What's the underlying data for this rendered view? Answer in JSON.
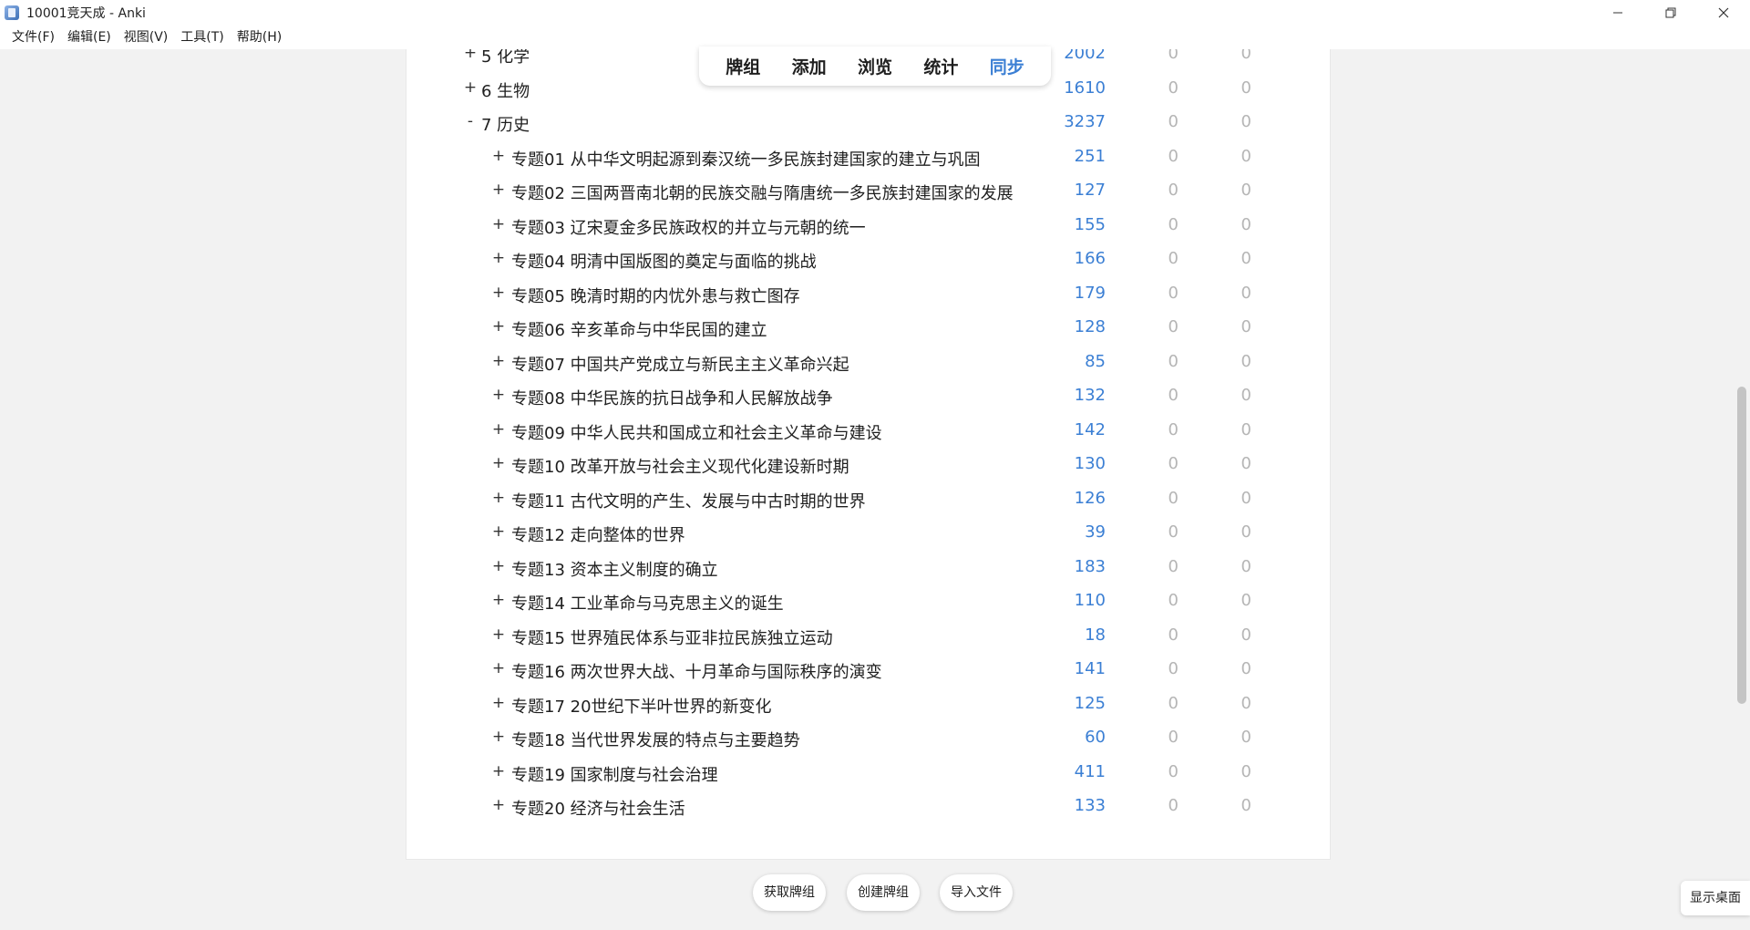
{
  "window": {
    "title": "10001竞天成 - Anki"
  },
  "menu": [
    {
      "label": "文件(F)"
    },
    {
      "label": "编辑(E)"
    },
    {
      "label": "视图(V)"
    },
    {
      "label": "工具(T)"
    },
    {
      "label": "帮助(H)"
    }
  ],
  "toolbar": {
    "tabs": [
      {
        "label": "牌组"
      },
      {
        "label": "添加"
      },
      {
        "label": "浏览"
      },
      {
        "label": "统计"
      },
      {
        "label": "同步"
      }
    ],
    "active_tab": "同步"
  },
  "decks": [
    {
      "toggle": "+",
      "name": "5 化学",
      "level": 0,
      "new": "2002",
      "learn": "0",
      "due": "0"
    },
    {
      "toggle": "+",
      "name": "6 生物",
      "level": 0,
      "new": "1610",
      "learn": "0",
      "due": "0"
    },
    {
      "toggle": "-",
      "name": "7 历史",
      "level": 0,
      "new": "3237",
      "learn": "0",
      "due": "0"
    },
    {
      "toggle": "+",
      "name": "专题01 从中华文明起源到秦汉统一多民族封建国家的建立与巩固",
      "level": 1,
      "new": "251",
      "learn": "0",
      "due": "0"
    },
    {
      "toggle": "+",
      "name": "专题02 三国两晋南北朝的民族交融与隋唐统一多民族封建国家的发展",
      "level": 1,
      "new": "127",
      "learn": "0",
      "due": "0"
    },
    {
      "toggle": "+",
      "name": "专题03 辽宋夏金多民族政权的并立与元朝的统一",
      "level": 1,
      "new": "155",
      "learn": "0",
      "due": "0"
    },
    {
      "toggle": "+",
      "name": "专题04 明清中国版图的奠定与面临的挑战",
      "level": 1,
      "new": "166",
      "learn": "0",
      "due": "0"
    },
    {
      "toggle": "+",
      "name": "专题05 晚清时期的内忧外患与救亡图存",
      "level": 1,
      "new": "179",
      "learn": "0",
      "due": "0"
    },
    {
      "toggle": "+",
      "name": "专题06 辛亥革命与中华民国的建立",
      "level": 1,
      "new": "128",
      "learn": "0",
      "due": "0"
    },
    {
      "toggle": "+",
      "name": "专题07 中国共产党成立与新民主主义革命兴起",
      "level": 1,
      "new": "85",
      "learn": "0",
      "due": "0"
    },
    {
      "toggle": "+",
      "name": "专题08 中华民族的抗日战争和人民解放战争",
      "level": 1,
      "new": "132",
      "learn": "0",
      "due": "0"
    },
    {
      "toggle": "+",
      "name": "专题09 中华人民共和国成立和社会主义革命与建设",
      "level": 1,
      "new": "142",
      "learn": "0",
      "due": "0"
    },
    {
      "toggle": "+",
      "name": "专题10 改革开放与社会主义现代化建设新时期",
      "level": 1,
      "new": "130",
      "learn": "0",
      "due": "0"
    },
    {
      "toggle": "+",
      "name": "专题11 古代文明的产生、发展与中古时期的世界",
      "level": 1,
      "new": "126",
      "learn": "0",
      "due": "0"
    },
    {
      "toggle": "+",
      "name": "专题12 走向整体的世界",
      "level": 1,
      "new": "39",
      "learn": "0",
      "due": "0"
    },
    {
      "toggle": "+",
      "name": "专题13 资本主义制度的确立",
      "level": 1,
      "new": "183",
      "learn": "0",
      "due": "0"
    },
    {
      "toggle": "+",
      "name": "专题14 工业革命与马克思主义的诞生",
      "level": 1,
      "new": "110",
      "learn": "0",
      "due": "0"
    },
    {
      "toggle": "+",
      "name": "专题15 世界殖民体系与亚非拉民族独立运动",
      "level": 1,
      "new": "18",
      "learn": "0",
      "due": "0"
    },
    {
      "toggle": "+",
      "name": "专题16 两次世界大战、十月革命与国际秩序的演变",
      "level": 1,
      "new": "141",
      "learn": "0",
      "due": "0"
    },
    {
      "toggle": "+",
      "name": "专题17 20世纪下半叶世界的新变化",
      "level": 1,
      "new": "125",
      "learn": "0",
      "due": "0"
    },
    {
      "toggle": "+",
      "name": "专题18 当代世界发展的特点与主要趋势",
      "level": 1,
      "new": "60",
      "learn": "0",
      "due": "0"
    },
    {
      "toggle": "+",
      "name": "专题19 国家制度与社会治理",
      "level": 1,
      "new": "411",
      "learn": "0",
      "due": "0"
    },
    {
      "toggle": "+",
      "name": "专题20 经济与社会生活",
      "level": 1,
      "new": "133",
      "learn": "0",
      "due": "0"
    }
  ],
  "bottom_buttons": [
    {
      "label": "获取牌组"
    },
    {
      "label": "创建牌组"
    },
    {
      "label": "导入文件"
    }
  ],
  "taskbar": {
    "show_desktop_label": "显示桌面"
  },
  "colors": {
    "new_count": "#3b7fd4",
    "zero_count": "#b5b5b5",
    "active_tab": "#3b7fd4",
    "background": "#f2f2f2"
  }
}
